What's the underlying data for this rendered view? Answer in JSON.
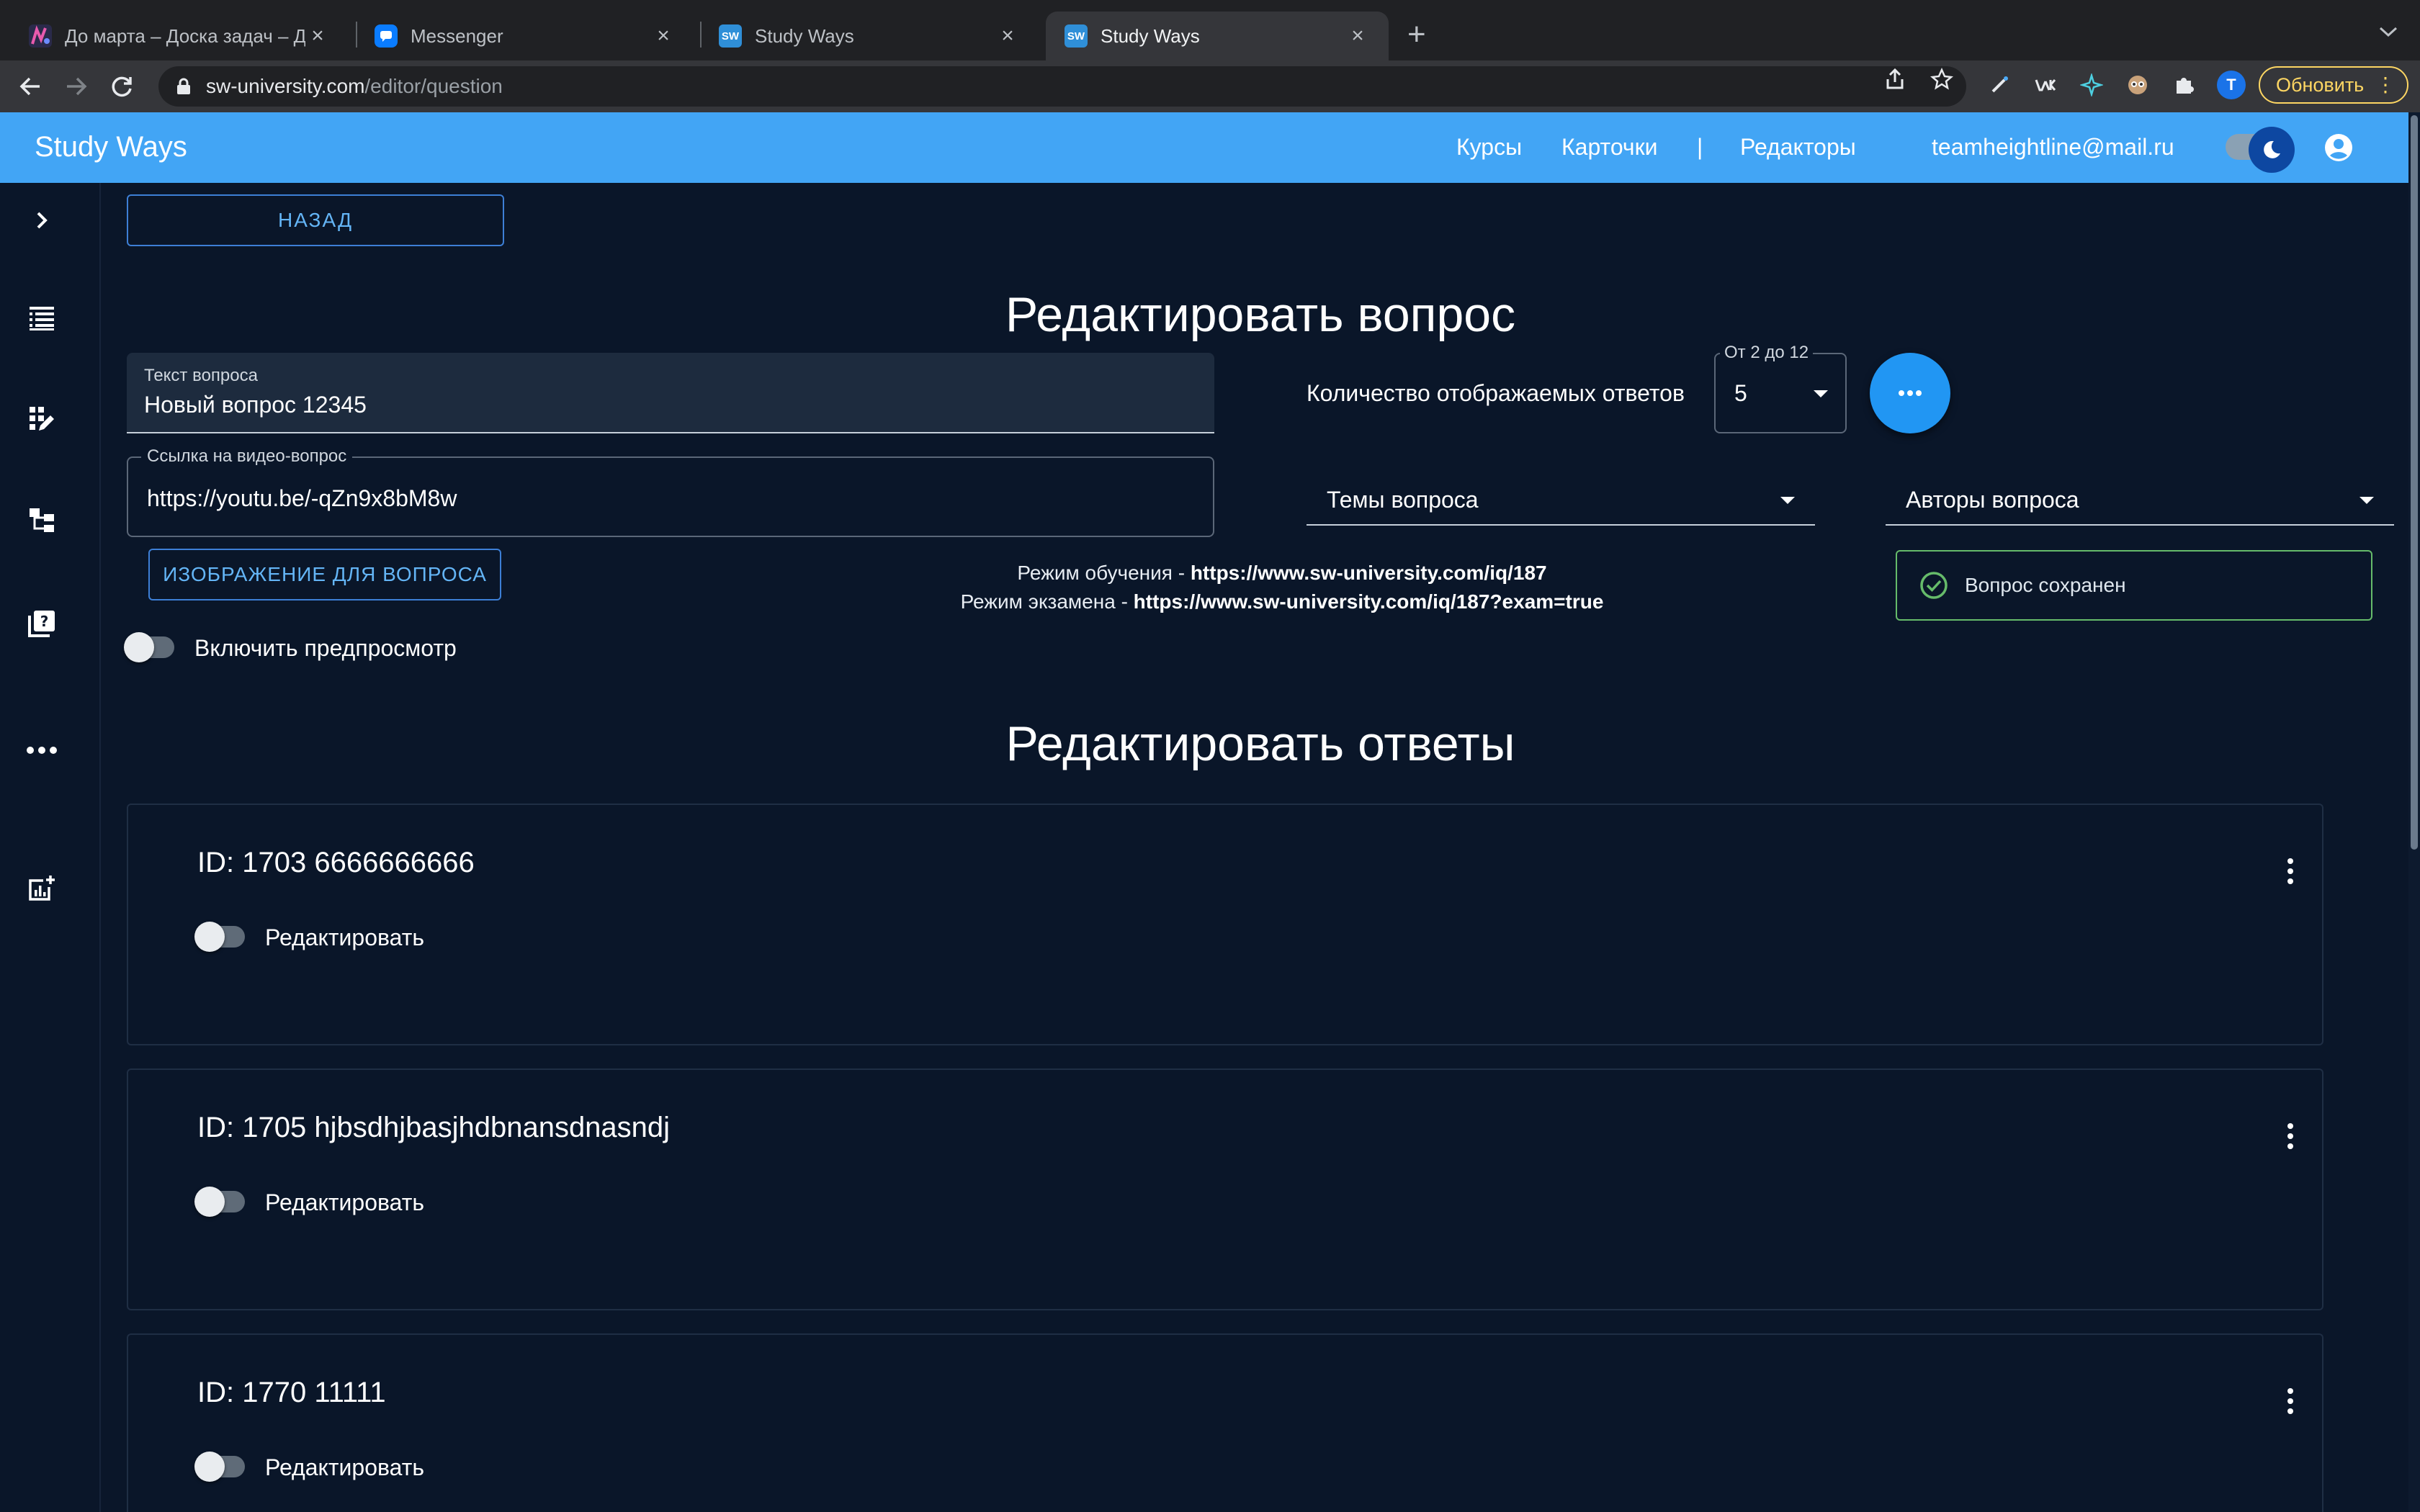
{
  "browser": {
    "tabs": [
      {
        "title": "До марта – Доска задач – До",
        "favicon": "taskboard-icon"
      },
      {
        "title": "Messenger",
        "favicon": "messenger-icon"
      },
      {
        "title": "Study Ways",
        "favicon": "SW"
      },
      {
        "title": "Study Ways",
        "favicon": "SW",
        "active": true
      }
    ],
    "url_host": "sw-university.com",
    "url_path": "/editor/question",
    "profile_letter": "T",
    "update_label": "Обновить",
    "extensions": [
      "pen-icon",
      "vk-icon",
      "star-sparkle-icon",
      "mask-icon",
      "puzzle-icon"
    ]
  },
  "header": {
    "brand": "Study Ways",
    "nav": [
      "Курсы",
      "Карточки",
      "|",
      "Редакторы"
    ],
    "user_email": "teamheightline@mail.ru",
    "accent": "#42a5f5"
  },
  "sidebar": {
    "icons": [
      "chevron-right-icon",
      "list-icon",
      "edit-grid-icon",
      "tree-icon",
      "quiz-icon",
      "more-horiz-icon",
      "add-chart-icon"
    ]
  },
  "page": {
    "back_label": "НАЗАД",
    "title": "Редактировать вопрос",
    "question_text_label": "Текст вопроса",
    "question_text_value": "Новый вопрос 12345",
    "video_label": "Ссылка на видео-вопрос",
    "video_value": "https://youtu.be/-qZn9x8bM8w",
    "image_button": "ИЗОБРАЖЕНИЕ ДЛЯ ВОПРОСА",
    "preview_toggle_label": "Включить предпросмотр",
    "count_label": "Количество отображаемых ответов",
    "count_hint": "От 2 до 12",
    "count_value": "5",
    "topics_placeholder": "Темы вопроса",
    "authors_placeholder": "Авторы вопроса",
    "study_mode_prefix": "Режим обучения - ",
    "study_mode_link": "https://www.sw-university.com/iq/187",
    "exam_mode_prefix": "Режим экзамена - ",
    "exam_mode_link": "https://www.sw-university.com/iq/187?exam=true",
    "saved_alert": "Вопрос сохранен",
    "saved_color": "#66bb6a",
    "answers_title": "Редактировать ответы",
    "answers": [
      {
        "id_text": "ID: 1703 6666666666",
        "edit_label": "Редактировать"
      },
      {
        "id_text": "ID: 1705 hjbsdhjbasjhdbnansdnasndj",
        "edit_label": "Редактировать"
      },
      {
        "id_text": "ID: 1770 11111",
        "edit_label": "Редактировать"
      }
    ]
  }
}
